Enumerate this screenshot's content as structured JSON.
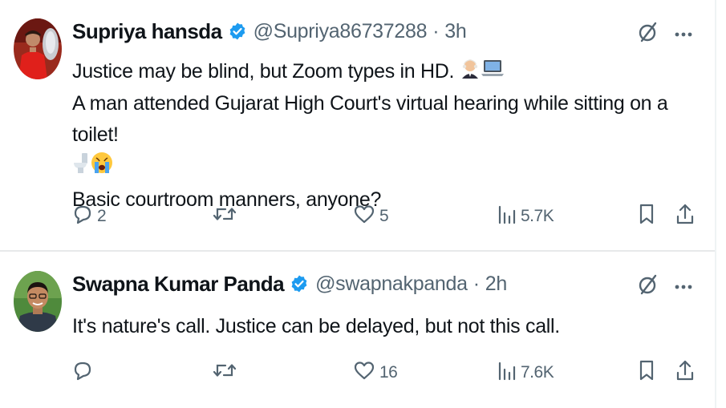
{
  "tweets": [
    {
      "display_name": "Supriya hansda",
      "handle": "@Supriya86737288",
      "separator": "·",
      "time": "3h",
      "lines": [
        "Justice may be blind, but Zoom types in HD.",
        "A man attended Gujarat High Court's virtual hearing while sitting on a toilet!",
        "",
        "Basic courtroom manners, anyone?"
      ],
      "emoji_line1": [
        "judge-emoji",
        "laptop-emoji"
      ],
      "emoji_line3": [
        "toilet-emoji",
        "crying-face-emoji"
      ],
      "replies": "2",
      "retweets": "",
      "likes": "5",
      "views": "5.7K"
    },
    {
      "display_name": "Swapna Kumar Panda",
      "handle": "@swapnakpanda",
      "separator": "·",
      "time": "2h",
      "lines": [
        "It's nature's call. Justice can be delayed, but not this call."
      ],
      "replies": "",
      "retweets": "",
      "likes": "16",
      "views": "7.6K"
    }
  ],
  "colors": {
    "text": "#0f1419",
    "secondary": "#536471",
    "verified": "#1d9bf0",
    "divider": "#e7e9ea"
  },
  "icons": {
    "verified": "verified-badge-icon",
    "grok": "grok-icon",
    "more": "more-icon",
    "reply": "reply-icon",
    "retweet": "retweet-icon",
    "like": "heart-icon",
    "views": "views-icon",
    "bookmark": "bookmark-icon",
    "share": "share-icon"
  }
}
